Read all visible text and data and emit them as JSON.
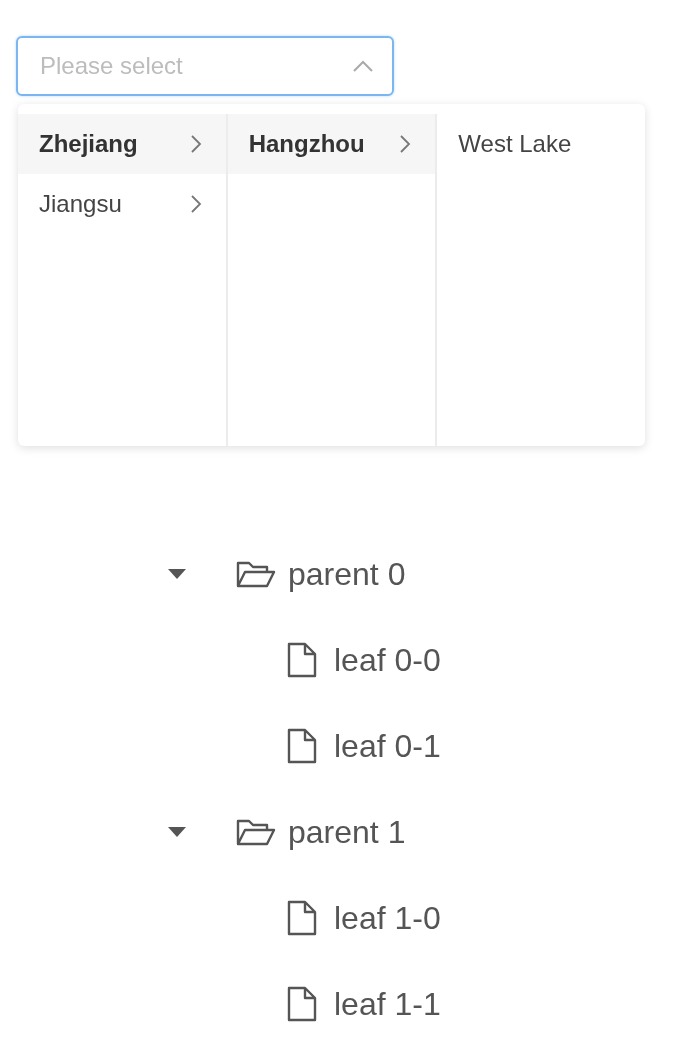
{
  "cascader": {
    "placeholder": "Please select",
    "open": true,
    "columns": [
      {
        "options": [
          {
            "label": "Zhejiang",
            "selected": true,
            "has_children": true
          },
          {
            "label": "Jiangsu",
            "selected": false,
            "has_children": true
          }
        ]
      },
      {
        "options": [
          {
            "label": "Hangzhou",
            "selected": true,
            "has_children": true
          }
        ]
      },
      {
        "options": [
          {
            "label": "West Lake",
            "selected": false,
            "has_children": false
          }
        ]
      }
    ]
  },
  "tree": [
    {
      "label": "parent 0",
      "expanded": true,
      "children": [
        {
          "label": "leaf 0-0"
        },
        {
          "label": "leaf 0-1"
        }
      ]
    },
    {
      "label": "parent 1",
      "expanded": true,
      "children": [
        {
          "label": "leaf 1-0"
        },
        {
          "label": "leaf 1-1"
        }
      ]
    }
  ]
}
